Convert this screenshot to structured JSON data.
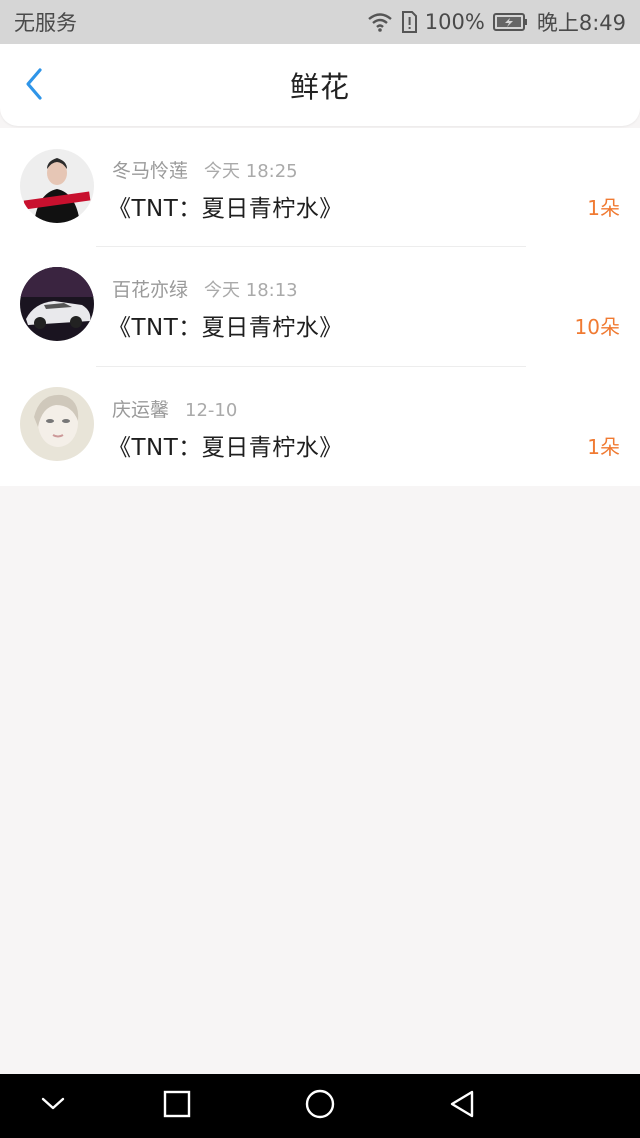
{
  "status_bar": {
    "carrier": "无服务",
    "battery": "100%",
    "time": "晚上8:49",
    "icons": [
      "wifi-icon",
      "sim-alert-icon",
      "battery-icon"
    ]
  },
  "header": {
    "title": "鲜花",
    "back_icon": "chevron-left-icon"
  },
  "flowers": [
    {
      "name": "冬马怜莲",
      "time": "今天 18:25",
      "book": "《TNT：夏日青柠水》",
      "count": "1朵"
    },
    {
      "name": "百花亦绿",
      "time": "今天 18:13",
      "book": "《TNT：夏日青柠水》",
      "count": "10朵"
    },
    {
      "name": "庆运馨",
      "time": "12-10",
      "book": "《TNT：夏日青柠水》",
      "count": "1朵"
    }
  ],
  "nav_bar": {
    "icons": [
      "collapse-icon",
      "recent-apps-icon",
      "home-icon",
      "back-triangle-icon"
    ]
  },
  "colors": {
    "accent": "#2f95e8",
    "count": "#f07a32",
    "background": "#f7f5f5"
  }
}
